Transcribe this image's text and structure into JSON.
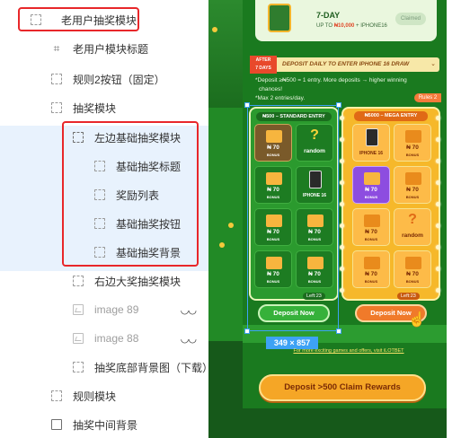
{
  "layers": [
    {
      "label": "老用户抽奖模块",
      "icon": "frame-dashed-icon",
      "level": 0
    },
    {
      "label": "老用户模块标题",
      "icon": "hash-icon",
      "level": 1
    },
    {
      "label": "规则2按钮（固定）",
      "icon": "frame-dashed-icon",
      "level": 1
    },
    {
      "label": "抽奖模块",
      "icon": "frame-dashed-icon",
      "level": 1
    },
    {
      "label": "左边基础抽奖模块",
      "icon": "frame-dashed-icon",
      "level": 2
    },
    {
      "label": "基础抽奖标题",
      "icon": "frame-dashed-icon",
      "level": 3
    },
    {
      "label": "奖励列表",
      "icon": "frame-dashed-icon",
      "level": 3
    },
    {
      "label": "基础抽奖按钮",
      "icon": "frame-dashed-icon",
      "level": 3
    },
    {
      "label": "基础抽奖背景",
      "icon": "frame-dashed-icon",
      "level": 3
    },
    {
      "label": "右边大奖抽奖模块",
      "icon": "frame-dashed-icon",
      "level": 2
    },
    {
      "label": "image 89",
      "icon": "image-icon",
      "level": 2,
      "hidden": true
    },
    {
      "label": "image 88",
      "icon": "image-icon",
      "level": 2,
      "hidden": true
    },
    {
      "label": "抽奖底部背景图（下载）",
      "icon": "frame-dashed-icon",
      "level": 2
    },
    {
      "label": "规则模块",
      "icon": "frame-dashed-icon",
      "level": 1
    },
    {
      "label": "抽奖中间背景",
      "icon": "frame-solid-icon",
      "level": 1
    }
  ],
  "hidden_eye": "◡◡",
  "phone": {
    "seven_day": {
      "title": "7-DAY",
      "subtitle_prefix": "UP TO ",
      "subtitle_amount": "₦10,000",
      "subtitle_suffix": " + IPHONE16",
      "claimed": "Claimed"
    },
    "banner": {
      "tag_line1": "AFTER",
      "tag_line2": "7 DAYS",
      "text": "DEPOSIT DAILY TO ENTER IPHONE 16 DRAW",
      "chevron": "⌄"
    },
    "note1": "*Deposit ≥₦500 = 1 entry. More deposits → higher winning",
    "note1b": "chances!",
    "note2": "*Max 2 entries/day.",
    "rules": "Rules 2",
    "left_title": "₦500 – STANDARD ENTRY",
    "right_title": "₦5000 – MEGA ENTRY",
    "left_cells": [
      {
        "kind": "coin",
        "amount": "₦ 70",
        "sub": "BONUS",
        "selected": true
      },
      {
        "kind": "random",
        "label": "random"
      },
      {
        "kind": "coin",
        "amount": "₦ 70",
        "sub": "BONUS"
      },
      {
        "kind": "iphone",
        "label": "IPHONE 16"
      },
      {
        "kind": "coin",
        "amount": "₦ 70",
        "sub": "BONUS"
      },
      {
        "kind": "coin",
        "amount": "₦ 70",
        "sub": "BONUS"
      },
      {
        "kind": "coin",
        "amount": "₦ 70",
        "sub": "BONUS"
      },
      {
        "kind": "coin",
        "amount": "₦ 70",
        "sub": "BONUS"
      }
    ],
    "right_cells": [
      {
        "kind": "iphone",
        "label": "IPHONE 16"
      },
      {
        "kind": "coin",
        "amount": "₦ 70",
        "sub": "BONUS"
      },
      {
        "kind": "coin-purple",
        "amount": "₦ 70",
        "sub": "BONUS"
      },
      {
        "kind": "coin",
        "amount": "₦ 70",
        "sub": "BONUS"
      },
      {
        "kind": "coin",
        "amount": "₦ 70",
        "sub": "BONUS"
      },
      {
        "kind": "random",
        "label": "random"
      },
      {
        "kind": "coin",
        "amount": "₦ 70",
        "sub": "BONUS"
      },
      {
        "kind": "coin",
        "amount": "₦ 70",
        "sub": "BONUS"
      }
    ],
    "left_count": "Left:23",
    "right_count": "Left:23",
    "deposit_left": "Deposit Now",
    "deposit_right": "Deposit Now",
    "hand": "☝",
    "dimension": "349 × 857",
    "more_link": "For more exciting games and offers, visit iLOTBET",
    "bottom_button": "Deposit >500 Claim Rewards"
  }
}
